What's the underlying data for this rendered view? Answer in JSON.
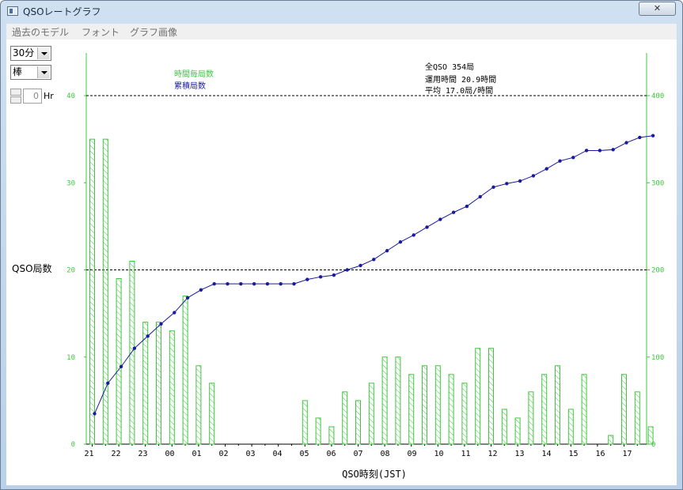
{
  "window": {
    "title": "QSOレートグラフ",
    "close_label": "✕"
  },
  "menu": [
    {
      "label": "過去のモデル"
    },
    {
      "label": "フォント"
    },
    {
      "label": "グラフ画像"
    }
  ],
  "controls": {
    "interval": {
      "value": "30分"
    },
    "style": {
      "value": "棒"
    },
    "hours": {
      "value": "0",
      "unit": "Hr"
    }
  },
  "stats": {
    "total": "全QSO 354局",
    "hours": "運用時間 20.9時間",
    "avg": "平均 17.0局/時間"
  },
  "legend": {
    "per_period": "時間毎局数",
    "cumulative": "累積局数"
  },
  "colors": {
    "bar": "#3cc83c",
    "line": "#1a1aa0",
    "axis": "#3cc83c"
  },
  "chart_data": {
    "type": "bar+line",
    "xlabel": "QSO時刻(JST)",
    "ylabel": "QSO局数",
    "left_axis": {
      "ylim": [
        0,
        40
      ],
      "ticks": [
        0,
        10,
        20,
        30,
        40
      ]
    },
    "right_axis": {
      "ylim": [
        0,
        400
      ],
      "ticks": [
        0,
        100,
        200,
        300,
        400
      ]
    },
    "x_tick_labels": [
      "21",
      "22",
      "23",
      "00",
      "01",
      "02",
      "03",
      "04",
      "05",
      "06",
      "07",
      "08",
      "09",
      "10",
      "11",
      "12",
      "13",
      "14",
      "15",
      "16",
      "17"
    ],
    "grid_lines_left": [
      20,
      40
    ],
    "series": [
      {
        "type": "bar",
        "axis": "left",
        "values": [
          35,
          35,
          19,
          21,
          14,
          14,
          13,
          17,
          9,
          7,
          0,
          0,
          0,
          0,
          0,
          0,
          5,
          3,
          2,
          6,
          5,
          7,
          10,
          10,
          8,
          9,
          9,
          8,
          7,
          11,
          11,
          4,
          3,
          6,
          8,
          9,
          4,
          8,
          0,
          1,
          8,
          6,
          2
        ]
      },
      {
        "type": "line",
        "axis": "right",
        "values": [
          35,
          70,
          89,
          110,
          124,
          138,
          151,
          168,
          177,
          184,
          184,
          184,
          184,
          184,
          184,
          184,
          189,
          192,
          194,
          200,
          205,
          212,
          222,
          232,
          240,
          249,
          258,
          266,
          273,
          284,
          295,
          299,
          302,
          308,
          316,
          325,
          329,
          337,
          337,
          338,
          346,
          352,
          354
        ]
      }
    ]
  }
}
